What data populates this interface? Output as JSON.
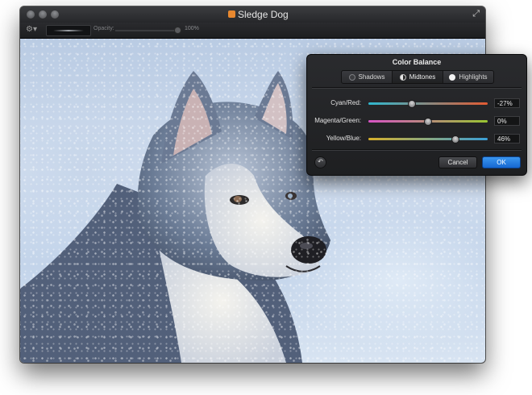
{
  "window": {
    "title": "Sledge Dog"
  },
  "toolbar": {
    "opacity_label": "Opacity:",
    "opacity_value": "100%"
  },
  "canvas": {
    "subject": "photo"
  },
  "color_balance": {
    "title": "Color Balance",
    "tabs": [
      {
        "label": "Shadows",
        "icon": "shadows-icon"
      },
      {
        "label": "Midtones",
        "icon": "midtones-icon",
        "active": true
      },
      {
        "label": "Highlights",
        "icon": "highlights-icon"
      }
    ],
    "sliders": [
      {
        "label": "Cyan/Red:",
        "value": "-27%",
        "level": -27
      },
      {
        "label": "Magenta/Green:",
        "value": "0%",
        "level": 0
      },
      {
        "label": "Yellow/Blue:",
        "value": "46%",
        "level": 46
      }
    ],
    "cancel_label": "Cancel",
    "ok_label": "OK"
  },
  "colors": {
    "accent": "#1f76e0",
    "window_bg": "#1a1b1d"
  }
}
